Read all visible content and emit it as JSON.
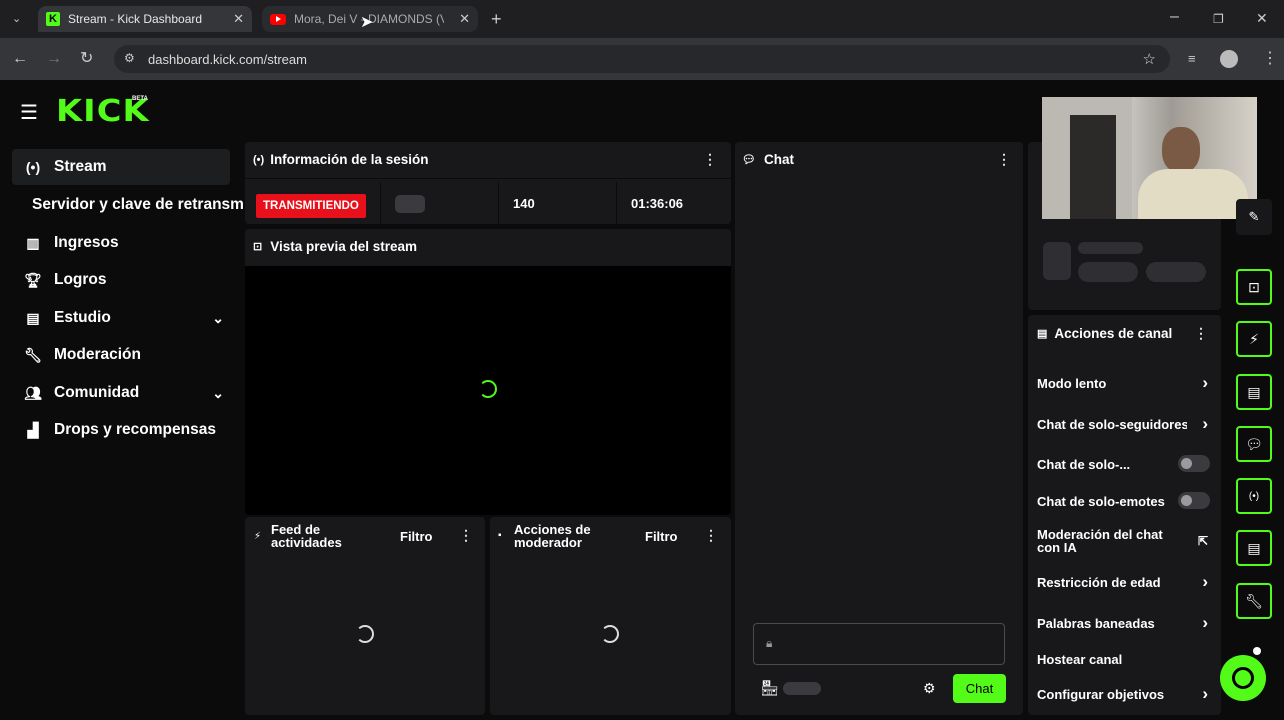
{
  "browser": {
    "tabs": [
      {
        "title": "Stream - Kick Dashboard"
      },
      {
        "title": "Mora, Dei V - DIAMONDS (Visu"
      }
    ],
    "url": "dashboard.kick.com/stream"
  },
  "brand": {
    "logo": "KICK",
    "badge": "BETA",
    "accent": "#53fc18"
  },
  "sidebar": {
    "items": [
      {
        "label": "Stream",
        "icon": "broadcast-icon"
      },
      {
        "label": "Servidor y clave de retransm"
      },
      {
        "label": "Ingresos",
        "icon": "chart-icon"
      },
      {
        "label": "Logros",
        "icon": "trophy-icon"
      },
      {
        "label": "Estudio",
        "icon": "studio-icon"
      },
      {
        "label": "Moderación",
        "icon": "wrench-icon"
      },
      {
        "label": "Comunidad",
        "icon": "community-icon"
      },
      {
        "label": "Drops y recompensas",
        "icon": "drops-icon"
      }
    ]
  },
  "session": {
    "title": "Información de la sesión",
    "status": "TRANSMITIENDO",
    "status_color": "#e8101a",
    "viewers": "140",
    "duration": "01:36:06"
  },
  "preview": {
    "title": "Vista previa del stream"
  },
  "activity_feed": {
    "title": "Feed de actividades",
    "filter": "Filtro"
  },
  "mod_actions": {
    "title": "Acciones de moderador",
    "filter": "Filtro"
  },
  "chat": {
    "title": "Chat",
    "send_label": "Chat"
  },
  "channel_actions": {
    "title": "Acciones de canal",
    "items": [
      {
        "label": "Modo lento"
      },
      {
        "label": "Chat de solo-seguidores"
      },
      {
        "label": "Chat de solo-..."
      },
      {
        "label": "Chat de solo-emotes"
      },
      {
        "label": "Moderación del chat con IA"
      },
      {
        "label": "Restricción de edad"
      },
      {
        "label": "Palabras baneadas"
      },
      {
        "label": "Hostear canal"
      },
      {
        "label": "Configurar objetivos"
      }
    ]
  }
}
